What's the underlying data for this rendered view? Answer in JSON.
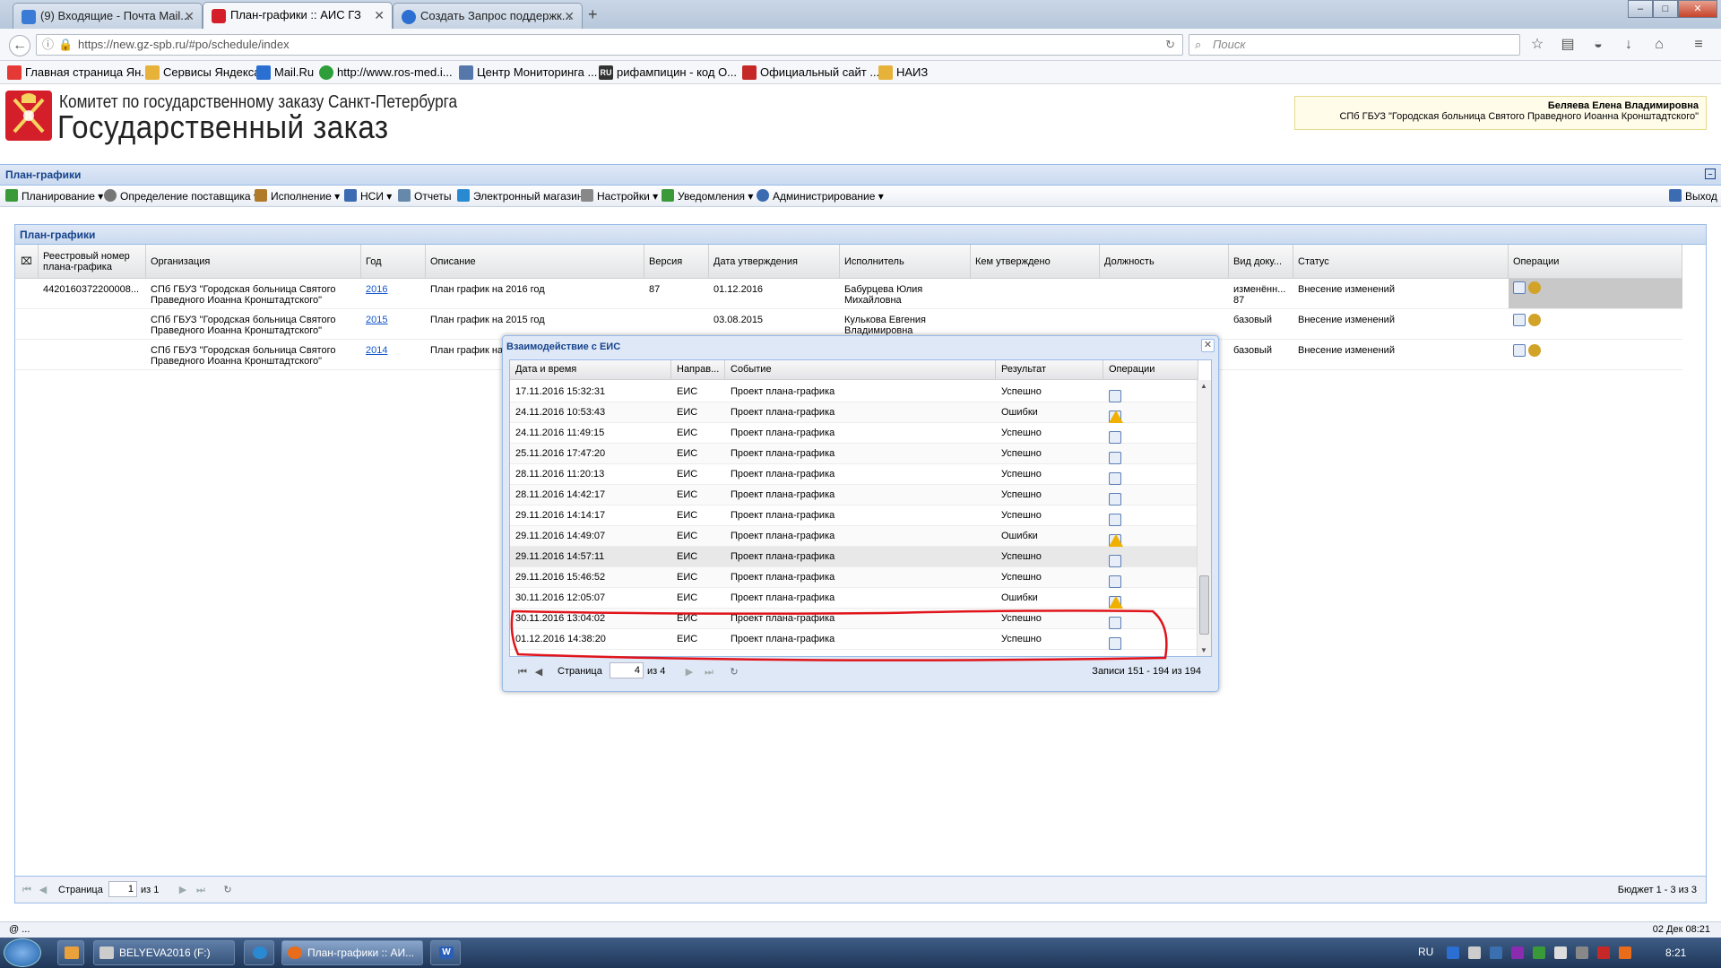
{
  "browser": {
    "tabs": [
      {
        "label": "(9) Входящие - Почта Mail...",
        "icon_color": "#3a7bd5"
      },
      {
        "label": "План-графики :: АИС ГЗ",
        "icon_color": "#d41f2a"
      },
      {
        "label": "Создать Запрос поддержк...",
        "icon_color": "#2a6fd1"
      }
    ],
    "new_tab_label": "+",
    "url": "https://new.gz-spb.ru/#po/schedule/index",
    "search_placeholder": "Поиск",
    "bookmarks": [
      {
        "label": "Главная страница Ян...",
        "icon_color": "#e53935"
      },
      {
        "label": "Сервисы Яндекса",
        "icon_color": "#e6b23a"
      },
      {
        "label": "Mail.Ru",
        "icon_color": "#2a6fd1"
      },
      {
        "label": "http://www.ros-med.i...",
        "icon_color": "#2e9e3a"
      },
      {
        "label": "Центр Мониторинга ...",
        "icon_color": "#5577aa"
      },
      {
        "label": "рифампицин - код О...",
        "icon_color": "#333333"
      },
      {
        "label": "Официальный сайт ...",
        "icon_color": "#c62828"
      },
      {
        "label": "НАИЗ",
        "icon_color": "#e6b23a"
      }
    ]
  },
  "header": {
    "org_line": "Комитет по государственному заказу Санкт-Петербурга",
    "title": "Государственный заказ",
    "user_name": "Беляева Елена Владимировна",
    "user_org": "СПб ГБУЗ \"Городская больница Святого Праведного Иоанна Кронштадтского\""
  },
  "section_title": "План-графики",
  "menu": [
    {
      "label": "Планирование ▾",
      "icon_color": "#3a9a3a"
    },
    {
      "label": "Определение поставщика ▾",
      "icon_color": "#777777"
    },
    {
      "label": "Исполнение ▾",
      "icon_color": "#b07a2a"
    },
    {
      "label": "НСИ ▾",
      "icon_color": "#3b6bb0"
    },
    {
      "label": "Отчеты",
      "icon_color": "#6688aa"
    },
    {
      "label": "Электронный магазин",
      "icon_color": "#2a8ad1"
    },
    {
      "label": "Настройки ▾",
      "icon_color": "#888888"
    },
    {
      "label": "Уведомления ▾",
      "icon_color": "#3a9a3a"
    },
    {
      "label": "Администрирование ▾",
      "icon_color": "#3b6bb0"
    }
  ],
  "exit_label": "Выход",
  "main_grid": {
    "title": "План-графики",
    "columns": [
      "Реестровый номер плана-графика",
      "Организация",
      "Год",
      "Описание",
      "Версия",
      "Дата утверждения",
      "Исполнитель",
      "Кем утверждено",
      "Должность",
      "Вид доку...",
      "Статус",
      "Операции"
    ],
    "rows": [
      {
        "reg_no": "4420160372200008...",
        "org": "СПб ГБУЗ \"Городская больница Святого Праведного Иоанна Кронштадтского\"",
        "year": "2016",
        "desc": "План график на 2016 год",
        "version": "87",
        "date": "01.12.2016",
        "executor": "Бабурцева Юлия Михайловна",
        "approved_by": "",
        "position": "",
        "doc_type": "изменённ... 87",
        "status": "Внесение изменений"
      },
      {
        "reg_no": "",
        "org": "СПб ГБУЗ \"Городская больница Святого Праведного Иоанна Кронштадтского\"",
        "year": "2015",
        "desc": "План график на 2015 год",
        "version": "",
        "date": "03.08.2015",
        "executor": "Кулькова Евгения Владимировна",
        "approved_by": "",
        "position": "",
        "doc_type": "базовый",
        "status": "Внесение изменений"
      },
      {
        "reg_no": "",
        "org": "СПб ГБУЗ \"Городская больница Святого Праведного Иоанна Кронштадтского\"",
        "year": "2014",
        "desc": "План график на",
        "version": "",
        "date": "",
        "executor": "",
        "approved_by": "",
        "position": "",
        "doc_type": "базовый",
        "status": "Внесение изменений"
      }
    ],
    "pager": {
      "page_label": "Страница",
      "page_value": "1",
      "of_label": "из 1",
      "summary": "Бюджет 1 - 3 из 3"
    }
  },
  "dialog": {
    "title": "Взаимодействие с ЕИС",
    "columns": [
      "Дата и время",
      "Направ...",
      "Событие",
      "Результат",
      "Операции"
    ],
    "rows": [
      {
        "datetime": "17.11.2016 15:32:31",
        "direction": "ЕИС",
        "event": "Проект плана-графика",
        "result": "Успешно",
        "warn": false
      },
      {
        "datetime": "24.11.2016 10:53:43",
        "direction": "ЕИС",
        "event": "Проект плана-графика",
        "result": "Ошибки",
        "warn": true
      },
      {
        "datetime": "24.11.2016 11:49:15",
        "direction": "ЕИС",
        "event": "Проект плана-графика",
        "result": "Успешно",
        "warn": false
      },
      {
        "datetime": "25.11.2016 17:47:20",
        "direction": "ЕИС",
        "event": "Проект плана-графика",
        "result": "Успешно",
        "warn": false
      },
      {
        "datetime": "28.11.2016 11:20:13",
        "direction": "ЕИС",
        "event": "Проект плана-графика",
        "result": "Успешно",
        "warn": false
      },
      {
        "datetime": "28.11.2016 14:42:17",
        "direction": "ЕИС",
        "event": "Проект плана-графика",
        "result": "Успешно",
        "warn": false
      },
      {
        "datetime": "29.11.2016 14:14:17",
        "direction": "ЕИС",
        "event": "Проект плана-графика",
        "result": "Успешно",
        "warn": false
      },
      {
        "datetime": "29.11.2016 14:49:07",
        "direction": "ЕИС",
        "event": "Проект плана-графика",
        "result": "Ошибки",
        "warn": true
      },
      {
        "datetime": "29.11.2016 14:57:11",
        "direction": "ЕИС",
        "event": "Проект плана-графика",
        "result": "Успешно",
        "warn": false
      },
      {
        "datetime": "29.11.2016 15:46:52",
        "direction": "ЕИС",
        "event": "Проект плана-графика",
        "result": "Успешно",
        "warn": false
      },
      {
        "datetime": "30.11.2016 12:05:07",
        "direction": "ЕИС",
        "event": "Проект плана-графика",
        "result": "Ошибки",
        "warn": true
      },
      {
        "datetime": "30.11.2016 13:04:02",
        "direction": "ЕИС",
        "event": "Проект плана-графика",
        "result": "Успешно",
        "warn": false
      },
      {
        "datetime": "01.12.2016 14:38:20",
        "direction": "ЕИС",
        "event": "Проект плана-графика",
        "result": "Успешно",
        "warn": false
      }
    ],
    "pager": {
      "page_label": "Страница",
      "page_value": "4",
      "of_label": "из 4",
      "summary": "Записи 151 - 194 из 194"
    }
  },
  "statusbar": {
    "left": "@ ...",
    "right": "02 Дек 08:21"
  },
  "taskbar": {
    "items": [
      {
        "label": "",
        "icon_color": "#e9a23b"
      },
      {
        "label": "BELYEVA2016 (F:)",
        "icon_color": "#cccccc"
      },
      {
        "label": "",
        "icon_color": "#2a8ad1"
      },
      {
        "label": "План-графики :: АИ...",
        "icon_color": "#e86c1a"
      },
      {
        "label": "",
        "icon_color": "#2b5fb6"
      }
    ],
    "lang": "RU",
    "clock": "8:21"
  }
}
